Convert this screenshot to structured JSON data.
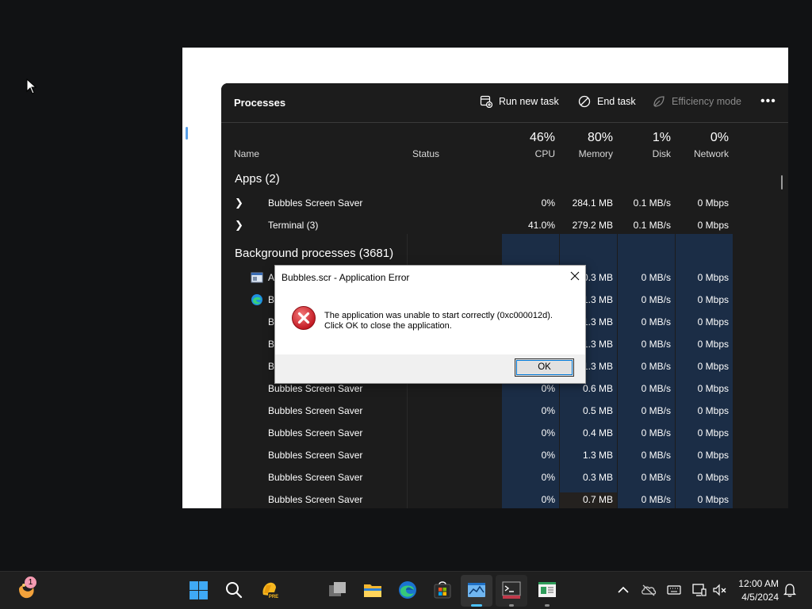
{
  "task_manager": {
    "title": "Processes",
    "toolbar": {
      "run_new_task": "Run new task",
      "end_task": "End task",
      "efficiency_mode": "Efficiency mode",
      "more": "•••"
    },
    "columns": {
      "name": "Name",
      "status": "Status",
      "cpu_pct": "46%",
      "cpu": "CPU",
      "memory_pct": "80%",
      "memory": "Memory",
      "disk_pct": "1%",
      "disk": "Disk",
      "network_pct": "0%",
      "network": "Network"
    },
    "apps_section": "Apps (2)",
    "apps": [
      {
        "name": "Bubbles Screen Saver",
        "cpu": "0%",
        "memory": "284.1 MB",
        "disk": "0.1 MB/s",
        "network": "0 Mbps"
      },
      {
        "name": "Terminal (3)",
        "cpu": "41.0%",
        "memory": "279.2 MB",
        "disk": "0.1 MB/s",
        "network": "0 Mbps"
      }
    ],
    "background_section": "Background processes (3681)",
    "background": [
      {
        "name": "A",
        "cpu": "",
        "memory": "0.3 MB",
        "disk": "0 MB/s",
        "network": "0 Mbps"
      },
      {
        "name": "B",
        "cpu": "",
        "memory": "1.3 MB",
        "disk": "0 MB/s",
        "network": "0 Mbps"
      },
      {
        "name": "B",
        "cpu": "",
        "memory": "1.3 MB",
        "disk": "0 MB/s",
        "network": "0 Mbps"
      },
      {
        "name": "B",
        "cpu": "",
        "memory": "1.3 MB",
        "disk": "0 MB/s",
        "network": "0 Mbps"
      },
      {
        "name": "B",
        "cpu": "",
        "memory": "1.3 MB",
        "disk": "0 MB/s",
        "network": "0 Mbps"
      },
      {
        "name": "Bubbles Screen Saver",
        "cpu": "0%",
        "memory": "0.6 MB",
        "disk": "0 MB/s",
        "network": "0 Mbps"
      },
      {
        "name": "Bubbles Screen Saver",
        "cpu": "0%",
        "memory": "0.5 MB",
        "disk": "0 MB/s",
        "network": "0 Mbps"
      },
      {
        "name": "Bubbles Screen Saver",
        "cpu": "0%",
        "memory": "0.4 MB",
        "disk": "0 MB/s",
        "network": "0 Mbps"
      },
      {
        "name": "Bubbles Screen Saver",
        "cpu": "0%",
        "memory": "1.3 MB",
        "disk": "0 MB/s",
        "network": "0 Mbps"
      },
      {
        "name": "Bubbles Screen Saver",
        "cpu": "0%",
        "memory": "0.3 MB",
        "disk": "0 MB/s",
        "network": "0 Mbps"
      },
      {
        "name": "Bubbles Screen Saver",
        "cpu": "0%",
        "memory": "0.7 MB",
        "disk": "0 MB/s",
        "network": "0 Mbps"
      }
    ]
  },
  "dialog": {
    "title": "Bubbles.scr - Application Error",
    "message_line1": "The application was unable to start correctly (0xc000012d).",
    "message_line2": "Click OK to close the application.",
    "ok": "OK"
  },
  "taskbar": {
    "notification_badge": "1",
    "time": "12:00 AM",
    "date": "4/5/2024",
    "pinned": [
      "start-icon",
      "search-icon",
      "copilot-pre-icon",
      "task-view-icon",
      "file-explorer-icon",
      "edge-icon",
      "store-icon",
      "task-manager-icon",
      "terminal-icon",
      "notepad-icon"
    ]
  },
  "colors": {
    "heat_blue": "#1b2d46",
    "heat_dark": "#24211f",
    "accent": "#4cc2ff",
    "error_red": "#d9323f"
  }
}
